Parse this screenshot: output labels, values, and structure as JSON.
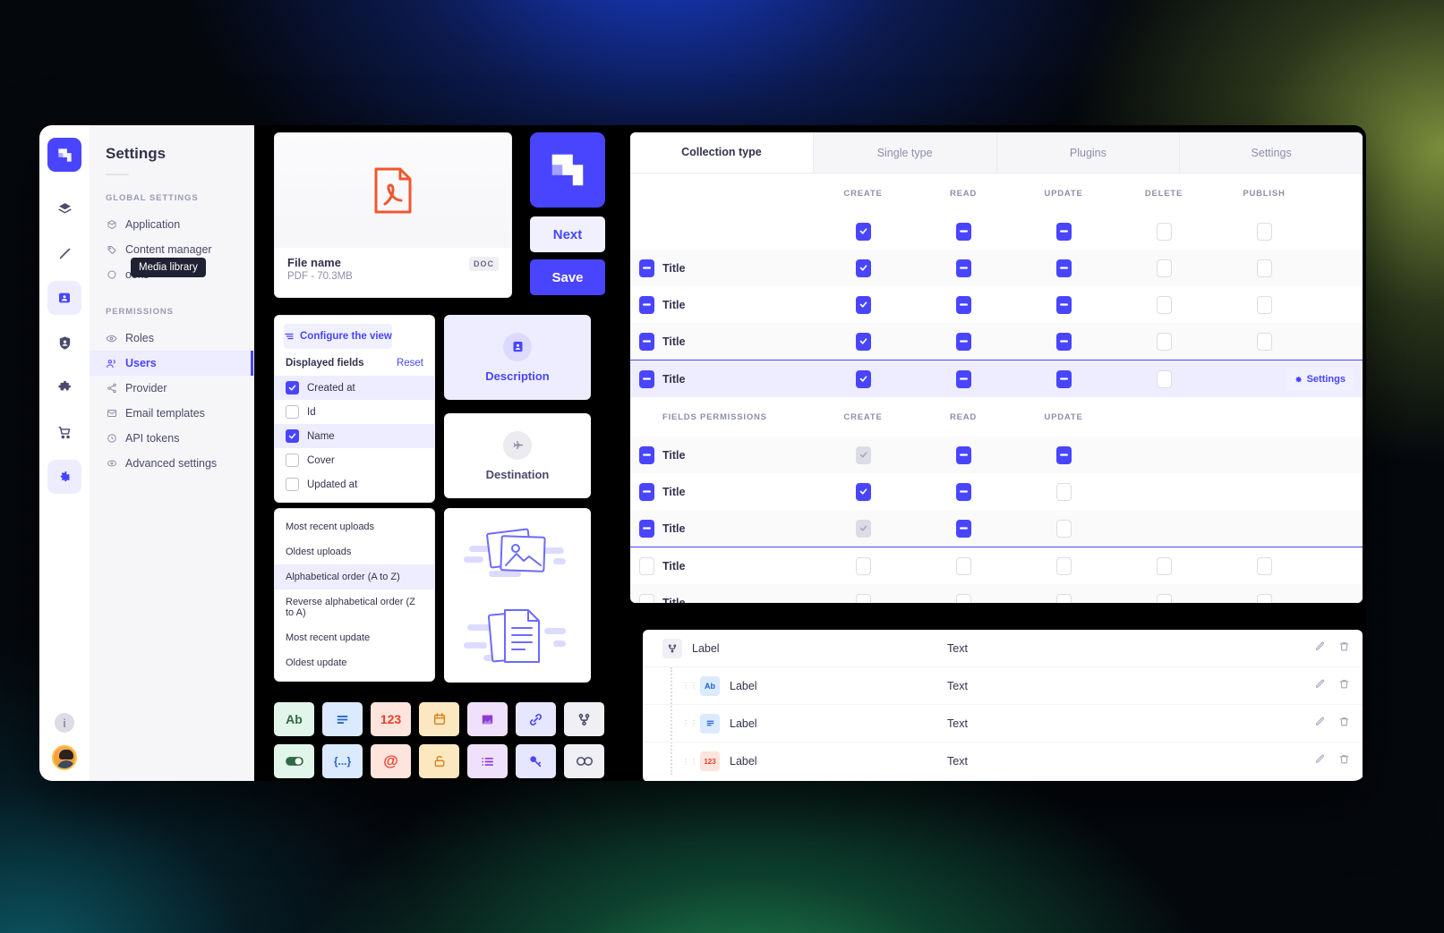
{
  "sidebar": {
    "title": "Settings",
    "rail": [
      {
        "name": "brand-logo",
        "icon": "strapi-logo"
      },
      {
        "name": "content-type-builder",
        "icon": "layers-icon"
      },
      {
        "name": "content-manager",
        "icon": "pencil-icon"
      },
      {
        "name": "media-library",
        "icon": "media-icon"
      },
      {
        "name": "users-permissions",
        "icon": "shield-user-icon"
      },
      {
        "name": "plugins",
        "icon": "puzzle-icon"
      },
      {
        "name": "marketplace",
        "icon": "cart-icon"
      },
      {
        "name": "settings",
        "icon": "gear-icon"
      }
    ],
    "tooltip": "Media library",
    "groups": [
      {
        "label": "GLOBAL SETTINGS",
        "items": [
          {
            "label": "Application",
            "icon": "box-icon"
          },
          {
            "label": "Content manager",
            "icon": "tag-icon"
          },
          {
            "label": "ooks",
            "icon": "webhook-icon"
          }
        ]
      },
      {
        "label": "PERMISSIONS",
        "items": [
          {
            "label": "Roles",
            "icon": "eye-icon"
          },
          {
            "label": "Users",
            "icon": "users-icon"
          },
          {
            "label": "Provider",
            "icon": "share-icon"
          },
          {
            "label": "Email templates",
            "icon": "mail-icon"
          },
          {
            "label": "API tokens",
            "icon": "clock-icon"
          },
          {
            "label": "Advanced settings",
            "icon": "sliders-icon"
          }
        ]
      }
    ],
    "info_icon": "info-icon"
  },
  "file_card": {
    "preview_icon": "pdf-file-icon",
    "name": "File name",
    "meta": "PDF - 70.3MB",
    "badge": "DOC"
  },
  "buttons": {
    "brand_tile_icon": "strapi-logo",
    "next": "Next",
    "save": "Save"
  },
  "displayed_fields": {
    "configure_label": "Configure the view",
    "configure_icon": "sliders-icon",
    "heading": "Displayed fields",
    "reset": "Reset",
    "items": [
      {
        "label": "Created at",
        "checked": true
      },
      {
        "label": "Id",
        "checked": false
      },
      {
        "label": "Name",
        "checked": true
      },
      {
        "label": "Cover",
        "checked": false
      },
      {
        "label": "Updated at",
        "checked": false
      }
    ]
  },
  "sort_options": {
    "items": [
      {
        "label": "Most recent uploads",
        "selected": false
      },
      {
        "label": "Oldest uploads",
        "selected": false
      },
      {
        "label": "Alphabetical order (A to Z)",
        "selected": true
      },
      {
        "label": "Reverse alphabetical order (Z to A)",
        "selected": false
      },
      {
        "label": "Most recent update",
        "selected": false
      },
      {
        "label": "Oldest update",
        "selected": false
      }
    ]
  },
  "step_cards": [
    {
      "label": "Description",
      "icon": "user-card-icon",
      "active": true
    },
    {
      "label": "Destination",
      "icon": "plane-icon",
      "active": false
    }
  ],
  "illustration_card": {
    "images_icon": "photos-illustration",
    "docs_icon": "documents-illustration"
  },
  "field_tiles": [
    {
      "name": "text-field",
      "glyph": "Ab",
      "bg": "#e2f5ea",
      "fg": "#2f6846"
    },
    {
      "name": "rich-text-field",
      "glyph": "lines",
      "bg": "#dbeafe",
      "fg": "#2563c9"
    },
    {
      "name": "number-field",
      "glyph": "123",
      "bg": "#fde4dd",
      "fg": "#e8412a"
    },
    {
      "name": "date-field",
      "glyph": "calendar",
      "bg": "#fbe8c0",
      "fg": "#d98324"
    },
    {
      "name": "media-field",
      "glyph": "image",
      "bg": "#efe0fb",
      "fg": "#8b3ad6"
    },
    {
      "name": "relation-field",
      "glyph": "link",
      "bg": "#e6e6ff",
      "fg": "#4945ff"
    },
    {
      "name": "component-field",
      "glyph": "branch",
      "bg": "#f0f0f4",
      "fg": "#4a4a6a"
    },
    {
      "name": "boolean-field",
      "glyph": "toggle",
      "bg": "#e2f5ea",
      "fg": "#2f6846"
    },
    {
      "name": "json-field",
      "glyph": "{...}",
      "bg": "#dbeafe",
      "fg": "#2563c9"
    },
    {
      "name": "email-field",
      "glyph": "@",
      "bg": "#fde4dd",
      "fg": "#e8412a"
    },
    {
      "name": "password-field",
      "glyph": "lock",
      "bg": "#fbe8c0",
      "fg": "#d98324"
    },
    {
      "name": "enumeration-field",
      "glyph": "list",
      "bg": "#efe0fb",
      "fg": "#8b3ad6"
    },
    {
      "name": "uid-field",
      "glyph": "key",
      "bg": "#e6e6ff",
      "fg": "#4945ff"
    },
    {
      "name": "dynamic-zone-field",
      "glyph": "infinity",
      "bg": "#f0f0f4",
      "fg": "#4a4a6a"
    }
  ],
  "permissions": {
    "tabs": [
      {
        "label": "Collection type",
        "active": true
      },
      {
        "label": "Single type",
        "active": false
      },
      {
        "label": "Plugins",
        "active": false
      },
      {
        "label": "Settings",
        "active": false
      }
    ],
    "columns": [
      "CREATE",
      "READ",
      "UPDATE",
      "DELETE",
      "PUBLISH"
    ],
    "header_states": [
      "checked",
      "indeterminate",
      "indeterminate",
      "off",
      "off"
    ],
    "rows": [
      {
        "label": "Title",
        "lead": "indeterminate",
        "states": [
          "checked",
          "indeterminate",
          "indeterminate",
          "off",
          "off"
        ],
        "selected": false
      },
      {
        "label": "Title",
        "lead": "indeterminate",
        "states": [
          "checked",
          "indeterminate",
          "indeterminate",
          "off",
          "off"
        ],
        "selected": false
      },
      {
        "label": "Title",
        "lead": "indeterminate",
        "states": [
          "checked",
          "indeterminate",
          "indeterminate",
          "off",
          "off"
        ],
        "selected": false
      },
      {
        "label": "Title",
        "lead": "indeterminate",
        "states": [
          "checked",
          "indeterminate",
          "indeterminate",
          "off",
          "off"
        ],
        "selected": true
      }
    ],
    "settings_button": "Settings",
    "settings_icon": "gear-icon",
    "fields_section": {
      "label": "FIELDS PERMISSIONS",
      "columns": [
        "CREATE",
        "READ",
        "UPDATE"
      ],
      "rows": [
        {
          "label": "Title",
          "lead": "indeterminate",
          "states": [
            "disabled-checked",
            "indeterminate",
            "indeterminate"
          ]
        },
        {
          "label": "Title",
          "lead": "indeterminate",
          "states": [
            "checked",
            "indeterminate",
            "off"
          ]
        },
        {
          "label": "Title",
          "lead": "indeterminate",
          "states": [
            "disabled-checked",
            "indeterminate",
            "off"
          ]
        }
      ]
    },
    "tail_rows": [
      {
        "label": "Title",
        "lead": "off",
        "states": [
          "off",
          "off",
          "off",
          "off",
          "off"
        ]
      },
      {
        "label": "Title",
        "lead": "off",
        "states": [
          "off",
          "off",
          "off",
          "off",
          "off"
        ]
      }
    ]
  },
  "field_list": {
    "rows": [
      {
        "label": "Label",
        "value": "Text",
        "tag": "",
        "tag_icon": "branch-icon",
        "indent": 0
      },
      {
        "label": "Label",
        "value": "Text",
        "tag": "Ab",
        "tag_icon": "",
        "indent": 1
      },
      {
        "label": "Label",
        "value": "Text",
        "tag": "",
        "tag_icon": "lines-icon",
        "indent": 1
      },
      {
        "label": "Label",
        "value": "Text",
        "tag": "123",
        "tag_icon": "",
        "indent": 1
      }
    ],
    "edit_icon": "pencil-icon",
    "delete_icon": "trash-icon"
  },
  "colors": {
    "primary": "#4945ff",
    "primary_light": "#eeedff",
    "text": "#32324d",
    "muted": "#8e8ea9"
  }
}
